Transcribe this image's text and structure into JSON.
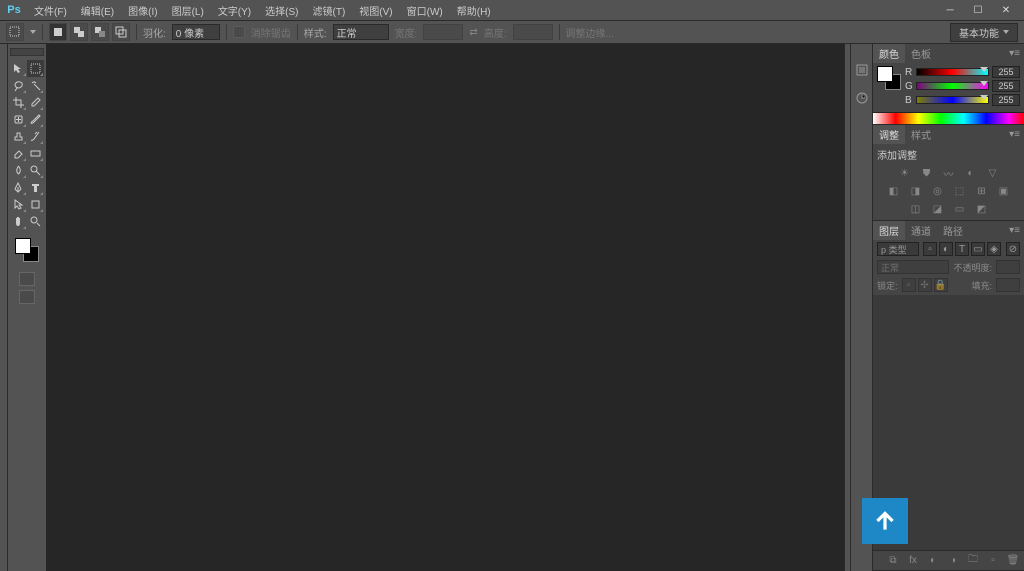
{
  "app": {
    "logo": "Ps"
  },
  "menu": [
    "文件(F)",
    "编辑(E)",
    "图像(I)",
    "图层(L)",
    "文字(Y)",
    "选择(S)",
    "滤镜(T)",
    "视图(V)",
    "窗口(W)",
    "帮助(H)"
  ],
  "options": {
    "feather_label": "羽化:",
    "feather_value": "0 像素",
    "antialias": "消除锯齿",
    "style_label": "样式:",
    "style_value": "正常",
    "width_label": "宽度:",
    "height_label": "高度:",
    "refine": "调整边缘..."
  },
  "workspace": "基本功能",
  "panels": {
    "color_tab": "颜色",
    "swatch_tab": "色板",
    "rgb": {
      "r": "R",
      "g": "G",
      "b": "B",
      "rv": "255",
      "gv": "255",
      "bv": "255"
    },
    "adjust_tab": "调整",
    "style_tab2": "样式",
    "adjust_add": "添加调整",
    "layers_tab": "图层",
    "channels_tab": "通道",
    "paths_tab": "路径",
    "kind": "p 类型",
    "blend": "正常",
    "opacity_label": "不透明度:",
    "lock_label": "锁定:",
    "fill_label": "填充:"
  }
}
